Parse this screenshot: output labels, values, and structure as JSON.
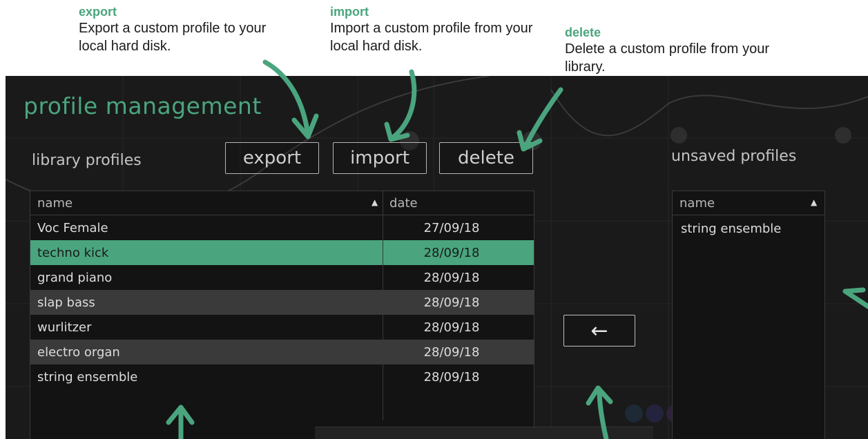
{
  "annotations": {
    "export": {
      "heading": "export",
      "body": "Export a custom profile to your local hard disk."
    },
    "import": {
      "heading": "import",
      "body": "Import a custom profile from your local hard disk."
    },
    "delete": {
      "heading": "delete",
      "body": "Delete a custom profile from your library."
    }
  },
  "panel": {
    "title": "profile management",
    "library_label": "library profiles",
    "unsaved_label": "unsaved profiles",
    "buttons": {
      "export": "export",
      "import": "import",
      "delete": "delete"
    },
    "move_button": "←"
  },
  "library_table": {
    "columns": {
      "name": "name",
      "date": "date",
      "sort_indicator": "▲"
    },
    "rows": [
      {
        "name": "Voc Female",
        "date": "27/09/18",
        "style": "light"
      },
      {
        "name": "techno kick",
        "date": "28/09/18",
        "style": "selected"
      },
      {
        "name": "grand piano",
        "date": "28/09/18",
        "style": "light"
      },
      {
        "name": "slap bass",
        "date": "28/09/18",
        "style": "gray"
      },
      {
        "name": "wurlitzer",
        "date": "28/09/18",
        "style": "light"
      },
      {
        "name": "electro organ",
        "date": "28/09/18",
        "style": "gray"
      },
      {
        "name": "string ensemble",
        "date": "28/09/18",
        "style": "light"
      }
    ]
  },
  "unsaved_table": {
    "columns": {
      "name": "name",
      "sort_indicator": "▲"
    },
    "rows": [
      {
        "name": "string ensemble"
      }
    ]
  },
  "colors": {
    "accent": "#4aa57e",
    "panel_bg": "#1a1a1a",
    "row_gray": "#3a3a3a"
  }
}
